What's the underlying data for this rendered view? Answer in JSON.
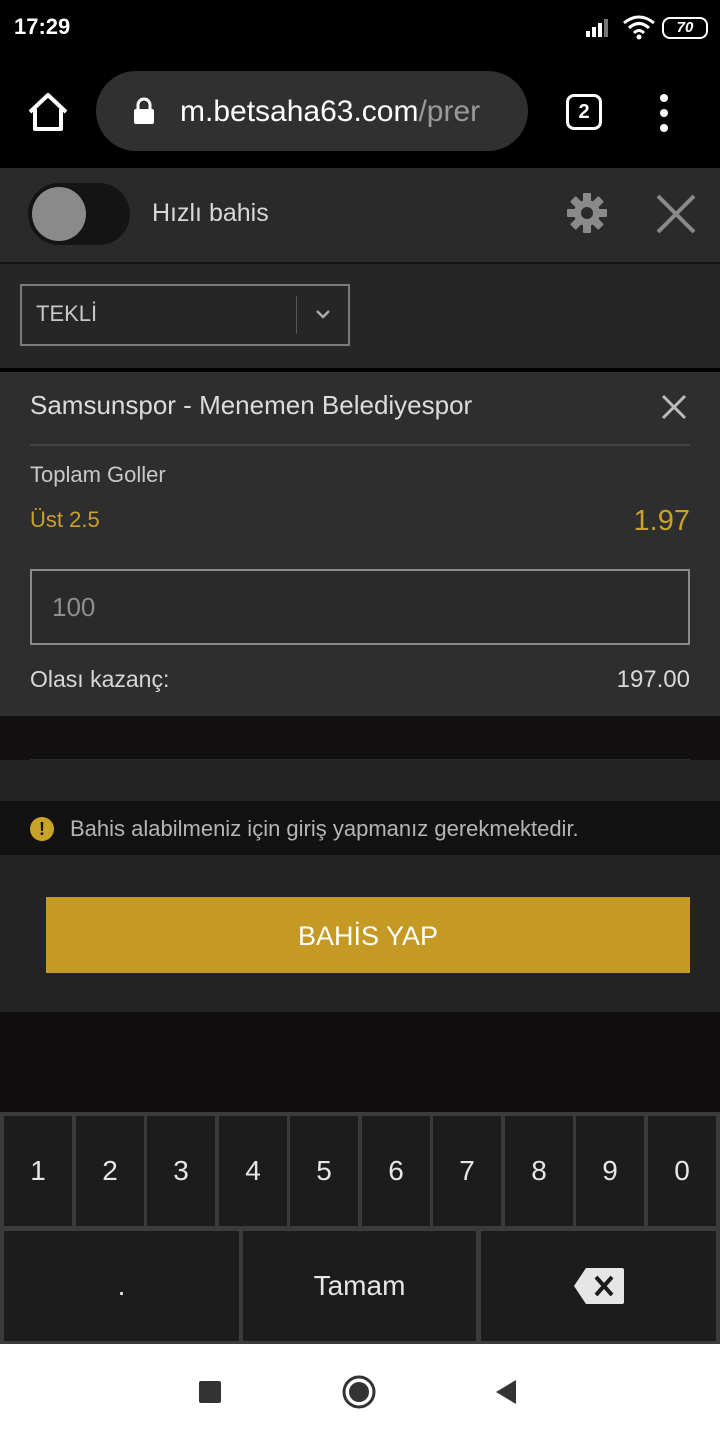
{
  "status_bar": {
    "time": "17:29",
    "battery": "70"
  },
  "browser": {
    "url_main": "m.betsaha63.com",
    "url_rest": "/prer",
    "tab_count": "2"
  },
  "header": {
    "quick_bet_label": "Hızlı bahis"
  },
  "bet_type": {
    "selected": "TEKLİ"
  },
  "bet": {
    "match": "Samsunspor - Menemen Belediyespor",
    "market": "Toplam Goller",
    "selection": "Üst 2.5",
    "odds": "1.97",
    "stake": "100",
    "potential_label": "Olası kazanç:",
    "potential_value": "197.00"
  },
  "warning": {
    "text": "Bahis alabilmeniz için giriş yapmanız gerekmektedir.",
    "icon": "!"
  },
  "actions": {
    "place_bet": "BAHİS YAP"
  },
  "keyboard": {
    "digits": [
      "1",
      "2",
      "3",
      "4",
      "5",
      "6",
      "7",
      "8",
      "9",
      "0"
    ],
    "dot": ".",
    "done": "Tamam"
  },
  "colors": {
    "accent": "#c49a25",
    "odds": "#c9a229",
    "background": "#232323"
  }
}
